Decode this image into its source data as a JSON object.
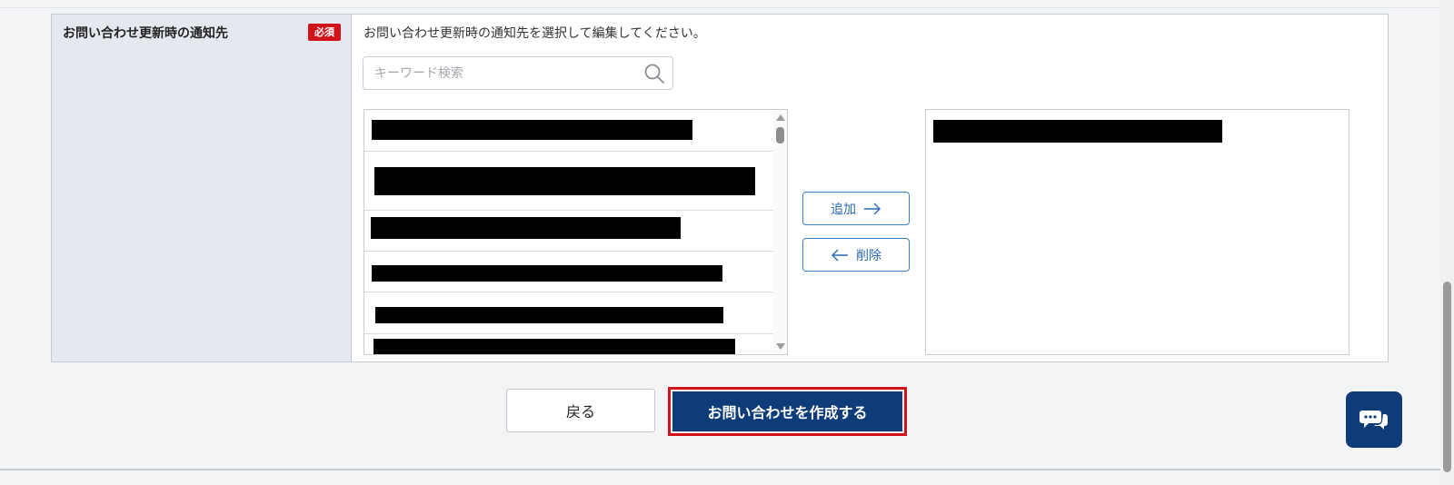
{
  "form": {
    "field_label": "お問い合わせ更新時の通知先",
    "required_badge": "必須",
    "instruction": "お問い合わせ更新時の通知先を選択して編集してください。",
    "search": {
      "placeholder": "キーワード検索",
      "value": ""
    },
    "available_list_count": 6,
    "selected_list_count": 1,
    "add_button": "追加",
    "remove_button": "削除"
  },
  "actions": {
    "back_label": "戻る",
    "create_label": "お問い合わせを作成する"
  },
  "icons": {
    "search": "search-icon",
    "add_arrow": "arrow-right-icon",
    "remove_arrow": "arrow-left-icon",
    "chat": "chat-bubbles-icon"
  },
  "colors": {
    "required_badge": "#d0121b",
    "primary_button": "#0e3c78",
    "highlight_outline": "#d0121b",
    "transfer_border": "#3a7fc9"
  }
}
